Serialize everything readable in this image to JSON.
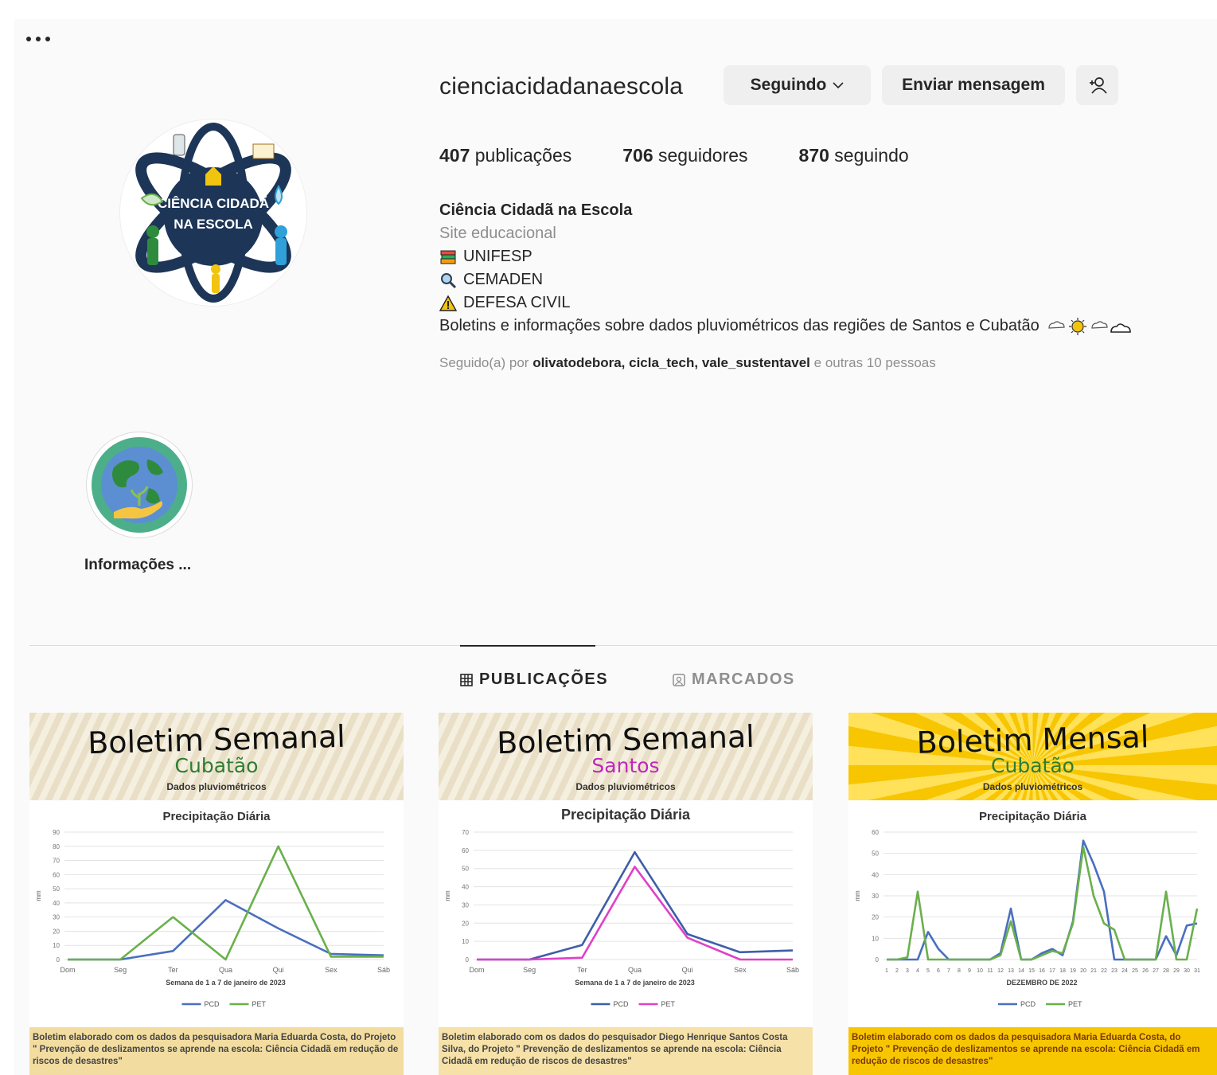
{
  "profile": {
    "username": "cienciacidadanaescola",
    "follow_button": "Seguindo",
    "message_button": "Enviar mensagem",
    "avatar_text_line1": "CIÊNCIA CIDADÃ",
    "avatar_text_line2": "NA ESCOLA"
  },
  "stats": {
    "posts_count": "407",
    "posts_label": "publicações",
    "followers_count": "706",
    "followers_label": "seguidores",
    "following_count": "870",
    "following_label": "seguindo"
  },
  "bio": {
    "name": "Ciência Cidadã na Escola",
    "category": "Site educacional",
    "line1": "UNIFESP",
    "line2": "CEMADEN",
    "line3": "DEFESA CIVIL",
    "line4": "Boletins e informações sobre dados pluviométricos das regiões de Santos e Cubatão",
    "line4_icon": "weather-icons"
  },
  "followed_by": {
    "prefix": "Seguido(a) por",
    "user1": "olivatodebora,",
    "user2": "cicla_tech,",
    "user3": "vale_sustentavel",
    "suffix": "e outras 10 pessoas"
  },
  "highlight": {
    "label": "Informações ..."
  },
  "tabs": {
    "posts": "PUBLICAÇÕES",
    "tagged": "MARCADOS"
  },
  "posts": [
    {
      "title": "Boletim Semanal",
      "subtitle": "Cubatão",
      "subtitle_color": "#2e7d32",
      "sub2": "Dados pluviométricos",
      "chart_title": "Precipitação Diária",
      "footer": "Boletim elaborado com os dados da pesquisadora Maria Eduarda Costa, do Projeto \" Prevenção de deslizamentos se aprende na escola: Ciência Cidadã em redução de riscos de desastres\""
    },
    {
      "title": "Boletim Semanal",
      "subtitle": "Santos",
      "subtitle_color": "#c026c0",
      "sub2": "Dados pluviométricos",
      "chart_title": "Precipitação Diária",
      "footer": "Boletim elaborado com os dados do pesquisador Diego Henrique Santos Costa Silva, do Projeto \" Prevenção de deslizamentos se aprende na escola: Ciência Cidadã em redução de riscos de desastres\""
    },
    {
      "title": "Boletim Mensal",
      "subtitle": "Cubatão",
      "subtitle_color": "#2e7d32",
      "sub2": "Dados pluviométricos",
      "chart_title": "Precipitação Diária",
      "footer": "Boletim elaborado com os dados da pesquisadora Maria Eduarda Costa, do Projeto \" Prevenção de deslizamentos se aprende na escola: Ciência Cidadã em redução de riscos de desastres\""
    }
  ],
  "chart_data": [
    {
      "type": "line",
      "title": "Precipitação Diária",
      "xlabel": "Semana de 1 a 7 de janeiro de 2023",
      "ylabel": "mm",
      "ylim": [
        0,
        90
      ],
      "yticks": [
        0,
        10,
        20,
        30,
        40,
        50,
        60,
        70,
        80,
        90
      ],
      "categories": [
        "Dom",
        "Seg",
        "Ter",
        "Qua",
        "Qui",
        "Sex",
        "Sáb"
      ],
      "series": [
        {
          "name": "PCD",
          "color": "#4a6fbf",
          "values": [
            0,
            0,
            6,
            42,
            22,
            4,
            3
          ]
        },
        {
          "name": "PET",
          "color": "#6ab04c",
          "values": [
            0,
            0,
            30,
            0,
            80,
            2,
            2
          ]
        }
      ]
    },
    {
      "type": "line",
      "title": "Precipitação Diária",
      "xlabel": "Semana de 1 a 7 de janeiro de 2023",
      "ylabel": "mm",
      "ylim": [
        0,
        70
      ],
      "yticks": [
        0,
        10,
        20,
        30,
        40,
        50,
        60,
        70
      ],
      "categories": [
        "Dom",
        "Seg",
        "Ter",
        "Qua",
        "Qui",
        "Sex",
        "Sáb"
      ],
      "series": [
        {
          "name": "PCD",
          "color": "#3f5ea8",
          "values": [
            0,
            0,
            8,
            59,
            14,
            4,
            5
          ]
        },
        {
          "name": "PET",
          "color": "#e040c8",
          "values": [
            0,
            0,
            1,
            51,
            12,
            0,
            0
          ]
        }
      ]
    },
    {
      "type": "line",
      "title": "Precipitação Diária",
      "xlabel": "DEZEMBRO DE 2022",
      "ylabel": "mm",
      "ylim": [
        0,
        60
      ],
      "yticks": [
        0,
        10,
        20,
        30,
        40,
        50,
        60
      ],
      "categories": [
        "1",
        "2",
        "3",
        "4",
        "5",
        "6",
        "7",
        "8",
        "9",
        "10",
        "11",
        "12",
        "13",
        "14",
        "15",
        "16",
        "17",
        "18",
        "19",
        "20",
        "21",
        "22",
        "23",
        "24",
        "25",
        "26",
        "27",
        "28",
        "29",
        "30",
        "31"
      ],
      "series": [
        {
          "name": "PCD",
          "color": "#4a6fbf",
          "values": [
            0,
            0,
            0,
            0,
            13,
            5,
            0,
            0,
            0,
            0,
            0,
            3,
            24,
            0,
            0,
            3,
            5,
            2,
            18,
            56,
            45,
            32,
            0,
            0,
            0,
            0,
            0,
            11,
            2,
            16,
            17
          ]
        },
        {
          "name": "PET",
          "color": "#6ab04c",
          "values": [
            0,
            0,
            1,
            32,
            0,
            0,
            0,
            0,
            0,
            0,
            0,
            2,
            18,
            0,
            0,
            2,
            4,
            3,
            17,
            53,
            30,
            17,
            14,
            0,
            0,
            0,
            0,
            32,
            0,
            0,
            24
          ]
        }
      ]
    }
  ]
}
